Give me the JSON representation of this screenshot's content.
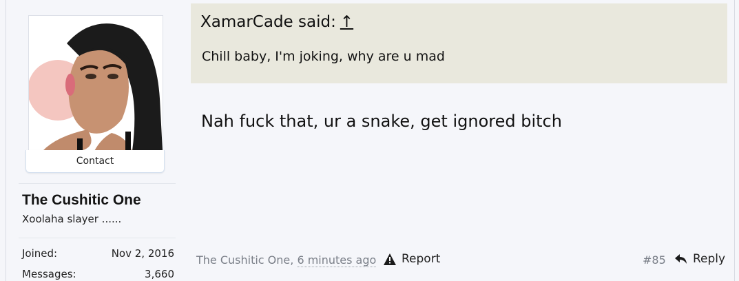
{
  "author": {
    "contact_label": "Contact",
    "username": "The Cushitic One",
    "user_title": "Xoolaha slayer ......",
    "stats": [
      {
        "label": "Joined:",
        "value": "Nov 2, 2016"
      },
      {
        "label": "Messages:",
        "value": "3,660"
      }
    ]
  },
  "quote": {
    "author_said": "XamarCade said:",
    "jump_icon": "↑",
    "text": "Chill baby, I'm joking, why are u mad"
  },
  "message": {
    "text": "Nah fuck that, ur a snake, get ignored bitch"
  },
  "footer": {
    "author": "The Cushitic One,",
    "time": "6 minutes ago",
    "report_label": "Report",
    "post_number": "#85",
    "reply_label": "Reply"
  }
}
